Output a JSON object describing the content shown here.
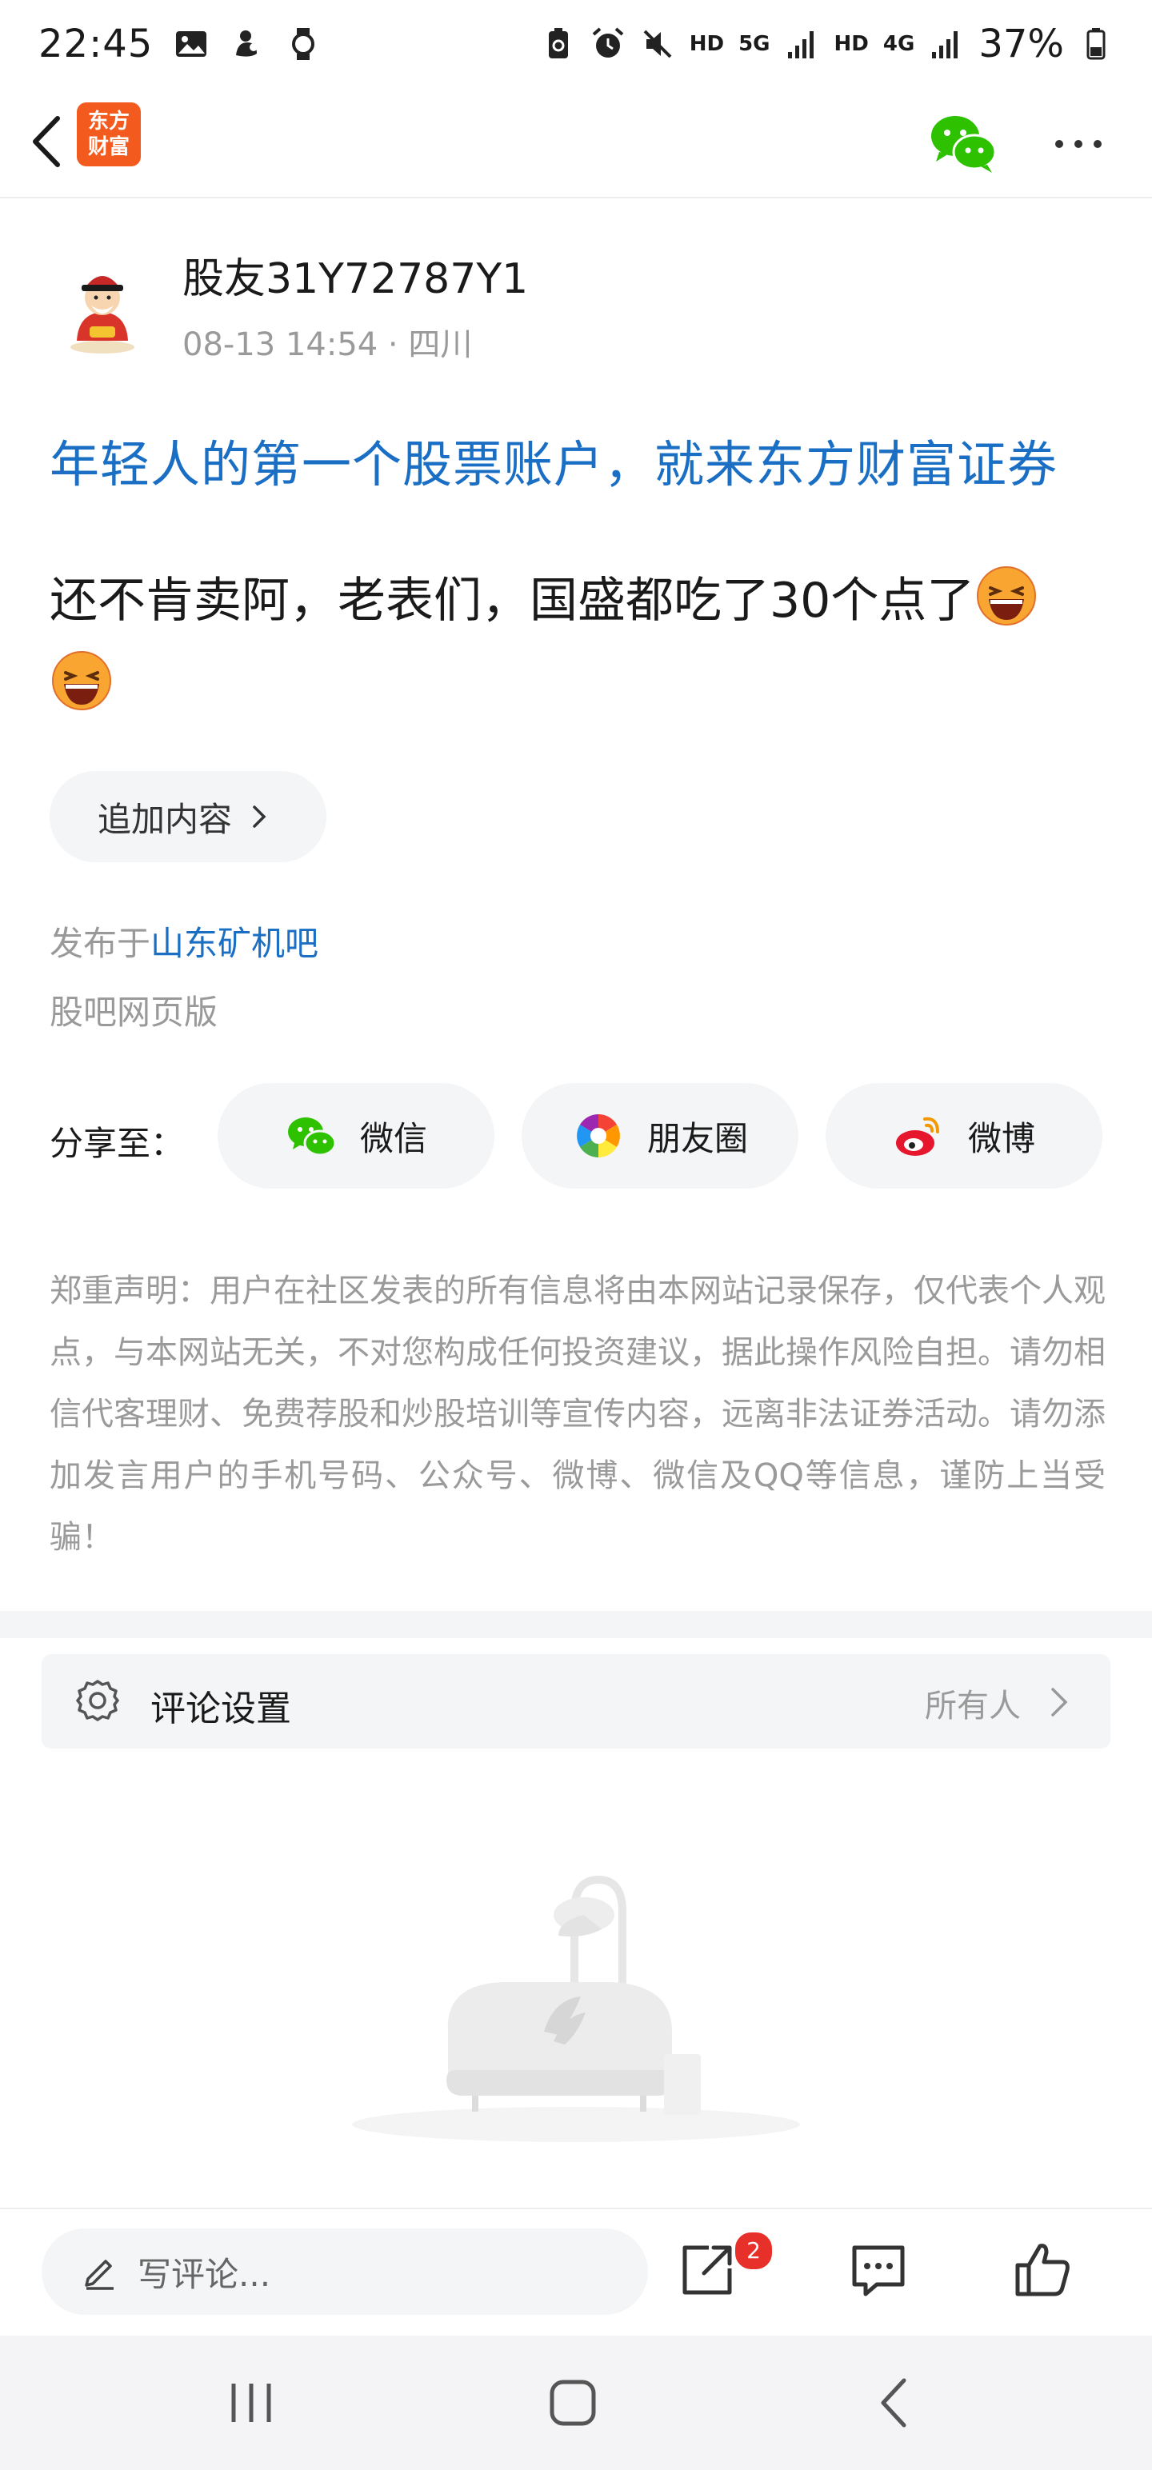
{
  "status_bar": {
    "time": "22:45",
    "network_labels": [
      "HD",
      "5G",
      "HD",
      "4G"
    ],
    "battery": "37%"
  },
  "header": {
    "app_logo_line1": "东方",
    "app_logo_line2": "财富",
    "logo_color": "#f25a1e"
  },
  "post": {
    "author": "股友31Y72787Y1",
    "meta": "08-13 14:54 · 四川",
    "promo_link": "年轻人的第一个股票账户，就来东方财富证券",
    "content": "还不肯卖阿，老表们，国盛都吃了30个点了",
    "emoji_icons": [
      "laughing-emoji",
      "laughing-emoji"
    ],
    "append_label": "追加内容",
    "published_prefix": "发布于",
    "bar_name": "山东矿机吧",
    "source": "股吧网页版",
    "link_color": "#1a6fc4"
  },
  "share": {
    "label": "分享至：",
    "wechat": "微信",
    "moments": "朋友圈",
    "weibo": "微博"
  },
  "disclaimer": "郑重声明：用户在社区发表的所有信息将由本网站记录保存，仅代表个人观点，与本网站无关，不对您构成任何投资建议，据此操作风险自担。请勿相信代客理财、免费荐股和炒股培训等宣传内容，远离非法证券活动。请勿添加发言用户的手机号码、公众号、微博、微信及QQ等信息，谨防上当受骗！",
  "comment_settings": {
    "label": "评论设置",
    "value": "所有人"
  },
  "bottom_bar": {
    "comment_placeholder": "写评论...",
    "share_badge": "2"
  }
}
